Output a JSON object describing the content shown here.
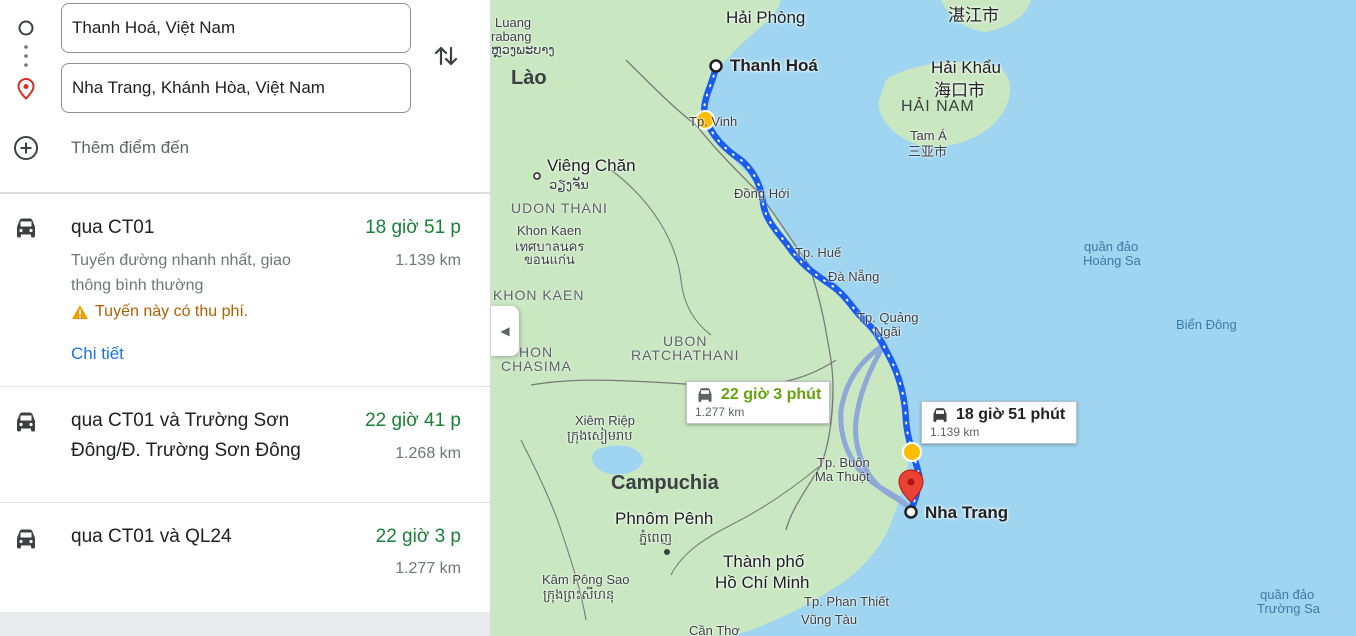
{
  "directions": {
    "origin": "Thanh Hoá, Việt Nam",
    "destination": "Nha Trang, Khánh Hòa, Việt Nam",
    "add_destination": "Thêm điểm đến"
  },
  "routes": [
    {
      "name": "qua CT01",
      "time": "18 giờ 51 p",
      "distance": "1.139 km",
      "description": "Tuyến đường nhanh nhất, giao thông bình thường",
      "warning": "Tuyến này có thu phí.",
      "details_link": "Chi tiết"
    },
    {
      "name": "qua CT01 và Trường Sơn Đông/Đ. Trường Sơn Đông",
      "time": "22 giờ 41 p",
      "distance": "1.268 km"
    },
    {
      "name": "qua CT01 và QL24",
      "time": "22 giờ 3 p",
      "distance": "1.277 km"
    }
  ],
  "map": {
    "labels": {
      "lao": "Lào",
      "cambodia": "Campuchia",
      "hai_phong": "Hải Phòng",
      "thanh_hoa": "Thanh Hoá",
      "vinh": "Tp. Vinh",
      "dong_hoi": "Đồng Hới",
      "hue": "Tp. Huế",
      "da_nang": "Đà Nẵng",
      "quang_ngai_1": "Tp. Quảng",
      "quang_ngai_2": "Ngãi",
      "buon_ma_thuot_1": "Tp. Buôn",
      "buon_ma_thuot_2": "Ma Thuột",
      "nha_trang": "Nha Trang",
      "vientiane": "Viêng Chăn",
      "vientiane_lao": "ວຽງຈັນ",
      "udon_thani": "UDON THANI",
      "khon_kaen": "Khon Kaen",
      "khon_kaen_thai": "เทศบาลนคร",
      "khon_kaen_thai2": "ขอนแก่น",
      "khon_kaen_region": "KHON KAEN",
      "ubon_1": "UBON",
      "ubon_2": "RATCHATHANI",
      "nakhon_1": "HON",
      "nakhon_2": "CHASIMA",
      "siem_reap": "Xiêm Riệp",
      "siem_reap_khmer": "ក្រុងសៀមរាប",
      "phnom_penh": "Phnôm Pênh",
      "phnom_penh_khmer": "ភ្នំពេញ",
      "hcmc_1": "Thành phố",
      "hcmc_2": "Hồ Chí Minh",
      "kampong_saom": "Kâm Pông Sao",
      "kampong_saom_khmer": "ក្រុងព្រះសីហនុ",
      "phan_thiet": "Tp. Phan Thiết",
      "vung_tau": "Vũng Tàu",
      "can_tho": "Cần Thơ",
      "luang_1": "Luang",
      "luang_2": "rabang",
      "luang_lao": "ຫຼວງພະບາງ",
      "zhanjiang": "湛江市",
      "haikou": "Hải Khẩu",
      "haikou_cn": "海口市",
      "hainan": "HẢI NAM",
      "sanya": "Tam Á",
      "sanya_cn": "三亚市",
      "paracel_1": "quần đảo",
      "paracel_2": "Hoàng Sa",
      "east_sea": "Biển Đông",
      "spratly_1": "quần đảo",
      "spratly_2": "Trường Sa"
    },
    "callouts": {
      "fastest": {
        "time": "18 giờ 51 phút",
        "distance": "1.139 km"
      },
      "alt": {
        "time": "22 giờ 3 phút",
        "distance": "1.277 km"
      }
    },
    "colors": {
      "route_primary": "#1a5cf0",
      "route_alt": "#8ea8d8",
      "water": "#9fd5f0",
      "land": "#c9e7c1"
    }
  }
}
